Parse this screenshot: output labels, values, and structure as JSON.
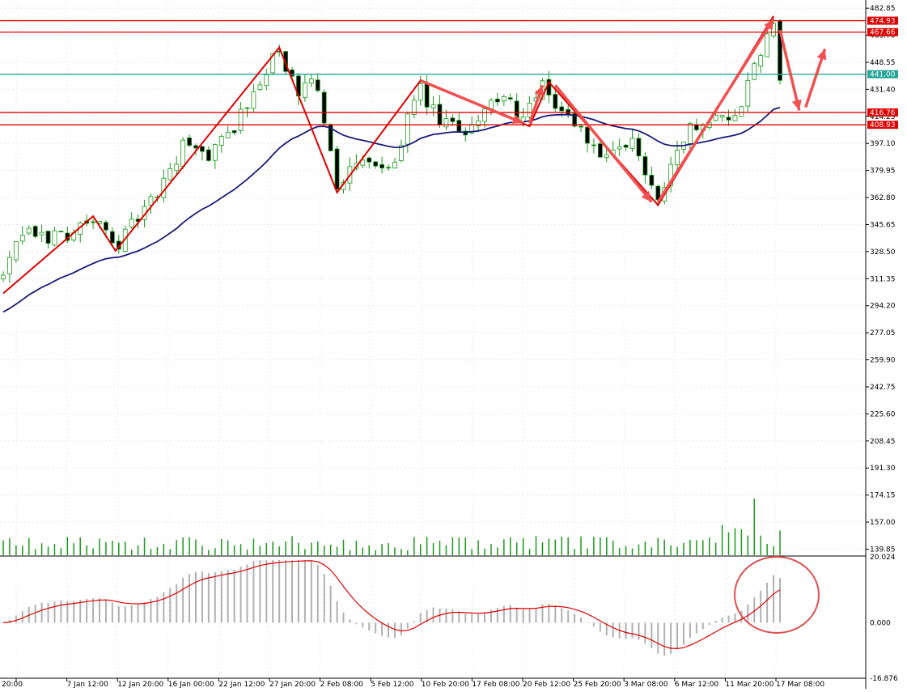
{
  "chart_data": {
    "type": "candlestick",
    "main_panel": {
      "y_ticks": [
        "482.85",
        "465.70",
        "448.55",
        "431.40",
        "414.25",
        "397.10",
        "379.95",
        "362.80",
        "345.65",
        "328.50",
        "311.35",
        "294.20",
        "277.05",
        "259.90",
        "242.75",
        "225.60",
        "208.45",
        "191.30",
        "174.15",
        "157.00",
        "139.85"
      ],
      "ylim": [
        136,
        486
      ],
      "horizontal_levels": [
        {
          "label": "474.93",
          "value": 474.93,
          "color": "#e00000",
          "tag_bg": "#e00000",
          "tag_fg": "#ffffff"
        },
        {
          "label": "467.66",
          "value": 467.66,
          "color": "#e00000",
          "tag_bg": "#e00000",
          "tag_fg": "#ffffff"
        },
        {
          "label": "441.00",
          "value": 441.0,
          "color": "#26a69a",
          "tag_bg": "#26a69a",
          "tag_fg": "#ffffff"
        },
        {
          "label": "416.76",
          "value": 416.76,
          "color": "#e00000",
          "tag_bg": "#e00000",
          "tag_fg": "#ffffff"
        },
        {
          "label": "408.93",
          "value": 408.93,
          "color": "#e00000",
          "tag_bg": "#e00000",
          "tag_fg": "#ffffff"
        }
      ],
      "candle_color_up": "#ffffff",
      "candle_color_down": "#000000",
      "candle_outline": "#1a9a1a",
      "moving_average_color": "#1a1a7a",
      "zigzag_color": "#e00000",
      "arrow_color": "#f05050",
      "volume_color": "#1a9a1a",
      "zigzag_points": [
        {
          "t": 0,
          "v": 302
        },
        {
          "t": 14,
          "v": 351
        },
        {
          "t": 17.5,
          "v": 329
        },
        {
          "t": 43,
          "v": 458
        },
        {
          "t": 52,
          "v": 366
        },
        {
          "t": 65,
          "v": 437
        },
        {
          "t": 82,
          "v": 408
        },
        {
          "t": 85,
          "v": 436
        },
        {
          "t": 102,
          "v": 358
        },
        {
          "t": 120,
          "v": 478
        }
      ],
      "arrows": [
        {
          "from": [
            65,
            437
          ],
          "to": [
            81,
            410
          ]
        },
        {
          "from": [
            82,
            410
          ],
          "to": [
            84,
            434
          ]
        },
        {
          "from": [
            86,
            434
          ],
          "to": [
            101,
            360
          ]
        },
        {
          "from": [
            102,
            360
          ],
          "to": [
            120,
            476
          ]
        },
        {
          "from": [
            121,
            469
          ],
          "to": [
            124,
            418
          ]
        },
        {
          "from": [
            125,
            420
          ],
          "to": [
            128,
            457
          ]
        }
      ]
    },
    "indicator_panel": {
      "y_ticks": [
        "20.024",
        "0.000",
        "-16.876"
      ],
      "ylim": [
        -16.876,
        20.024
      ],
      "histogram_color": "#b0b0b0",
      "signal_color": "#e00000",
      "highlight_circle_color": "#e05050"
    },
    "x_ticks": [
      "20:00",
      "7 Jan 12:00",
      "12 Jan 20:00",
      "16 Jan 00:00",
      "22 Jan 12:00",
      "27 Jan 20:00",
      "2 Feb 08:00",
      "5 Feb 12:00",
      "10 Feb 20:00",
      "17 Feb 08:00",
      "20 Feb 12:00",
      "25 Feb 20:00",
      "3 Mar 08:00",
      "6 Mar 12:00",
      "11 Mar 20:00",
      "17 Mar 08:00"
    ],
    "key_points": [
      {
        "t": 0,
        "v": 312
      },
      {
        "t": 3,
        "v": 340
      },
      {
        "t": 7,
        "v": 338
      },
      {
        "t": 10,
        "v": 340
      },
      {
        "t": 14,
        "v": 349
      },
      {
        "t": 17.5,
        "v": 332
      },
      {
        "t": 21,
        "v": 350
      },
      {
        "t": 24,
        "v": 365
      },
      {
        "t": 28,
        "v": 395
      },
      {
        "t": 32,
        "v": 390
      },
      {
        "t": 35,
        "v": 403
      },
      {
        "t": 38,
        "v": 420
      },
      {
        "t": 41,
        "v": 445
      },
      {
        "t": 43,
        "v": 455
      },
      {
        "t": 46,
        "v": 425
      },
      {
        "t": 48,
        "v": 440
      },
      {
        "t": 50,
        "v": 414
      },
      {
        "t": 52,
        "v": 372
      },
      {
        "t": 56,
        "v": 385
      },
      {
        "t": 60,
        "v": 378
      },
      {
        "t": 63,
        "v": 412
      },
      {
        "t": 65,
        "v": 430
      },
      {
        "t": 68,
        "v": 410
      },
      {
        "t": 72,
        "v": 405
      },
      {
        "t": 75,
        "v": 420
      },
      {
        "t": 78,
        "v": 425
      },
      {
        "t": 81,
        "v": 412
      },
      {
        "t": 84,
        "v": 432
      },
      {
        "t": 87,
        "v": 418
      },
      {
        "t": 90,
        "v": 405
      },
      {
        "t": 94,
        "v": 385
      },
      {
        "t": 98,
        "v": 398
      },
      {
        "t": 102,
        "v": 362
      },
      {
        "t": 105,
        "v": 395
      },
      {
        "t": 108,
        "v": 410
      },
      {
        "t": 111,
        "v": 416
      },
      {
        "t": 114,
        "v": 412
      },
      {
        "t": 117,
        "v": 445
      },
      {
        "t": 120,
        "v": 472
      },
      {
        "t": 121,
        "v": 441
      }
    ],
    "candle_count": 122
  }
}
